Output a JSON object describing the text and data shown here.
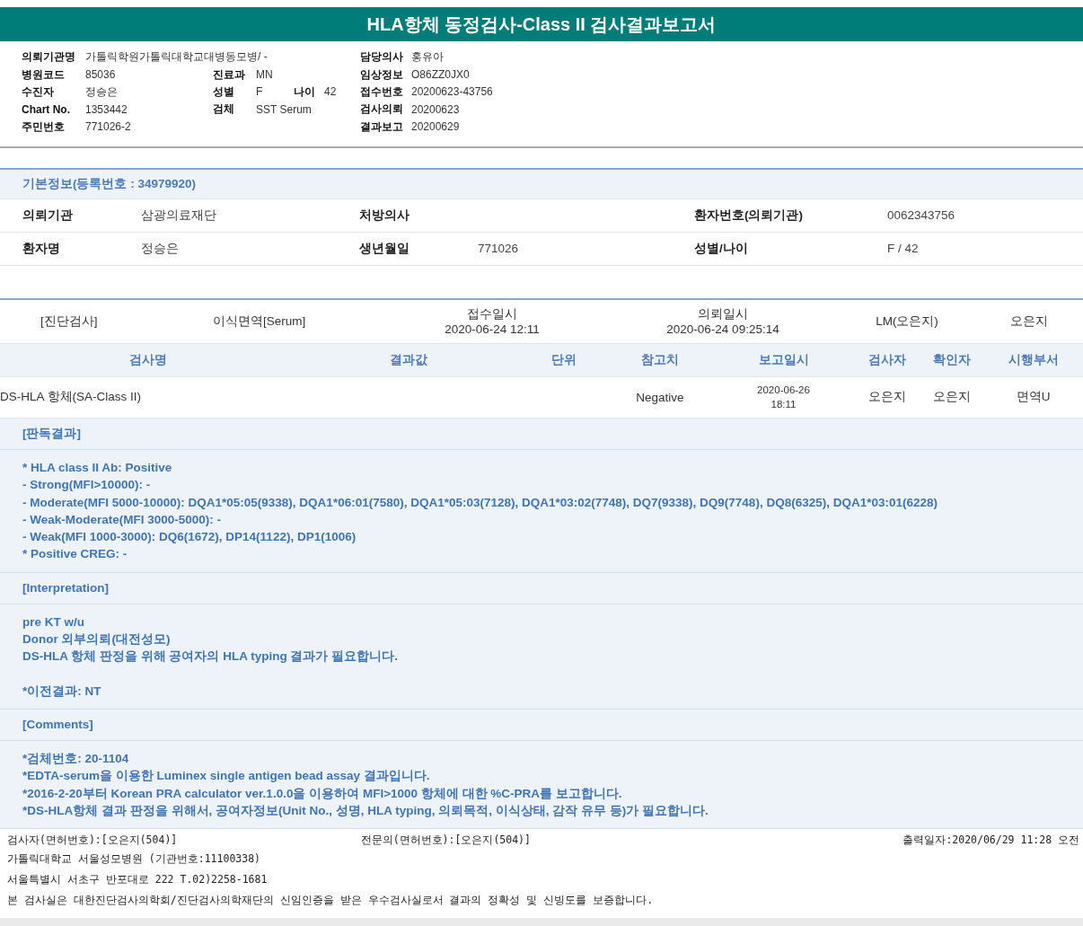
{
  "title": "HLA항체 동정검사-Class II 검사결과보고서",
  "header": {
    "rows": [
      {
        "left": {
          "label": "의뢰기관명",
          "value": "가톨릭학원가톨릭대학교대병동모병/ -"
        },
        "middle": [],
        "right": {
          "label": "담당의사",
          "value": "홍유아"
        }
      },
      {
        "left": {
          "label": "병원코드",
          "value": "85036"
        },
        "middle": [
          {
            "label": "진료과",
            "value": "MN"
          }
        ],
        "right": {
          "label": "임상정보",
          "value": "O86ZZ0JX0"
        }
      },
      {
        "left": {
          "label": "수진자",
          "value": "정승은"
        },
        "middle": [
          {
            "label": "성별",
            "value": "F"
          },
          {
            "label": "나이",
            "value": "42"
          }
        ],
        "right": {
          "label": "접수번호",
          "value": "20200623-43756"
        }
      },
      {
        "left": {
          "label": "Chart No.",
          "value": "1353442"
        },
        "middle": [
          {
            "label": "검체",
            "value": "SST Serum"
          }
        ],
        "right": {
          "label": "검사의뢰",
          "value": "20200623"
        }
      },
      {
        "left": {
          "label": "주민번호",
          "value": "771026-2"
        },
        "middle": [],
        "right": {
          "label": "결과보고",
          "value": "20200629"
        }
      }
    ]
  },
  "basic_info": {
    "title": "기본정보(등록번호 : 34979920)",
    "rows": [
      [
        {
          "label": "의뢰기관",
          "value": "삼광의료재단"
        },
        {
          "label": "처방의사"
        },
        {
          "label": "환자번호(의뢰기관)",
          "value": "0062343756"
        }
      ],
      [
        {
          "label": "환자명",
          "value": "정승은"
        },
        {
          "label": "생년월일",
          "value": "771026"
        },
        {
          "label": "성별/나이",
          "value": "F / 42"
        }
      ]
    ]
  },
  "order": [
    {
      "value": "[진단검사]"
    },
    {
      "value": "이식면역[Serum]"
    },
    {
      "label": "접수일시",
      "value": "2020-06-24 12:11"
    },
    {
      "label": "의뢰일시",
      "value": "2020-06-24 09:25:14"
    },
    {
      "value": "LM(오은지)"
    },
    {
      "value": "오은지"
    }
  ],
  "table": {
    "columns": [
      "검사명",
      "결과값",
      "단위",
      "참고치",
      "보고일시",
      "검사자",
      "확인자",
      "시행부서"
    ],
    "rows": [
      [
        "DS-HLA 항체(SA-Class II)",
        "",
        "",
        "Negative",
        "2020-06-26\n18:11",
        "오은지",
        "오은지",
        "면역U"
      ]
    ]
  },
  "sections": [
    {
      "title": "[판독결과]",
      "paragraphs": [
        [
          "* HLA class II Ab: Positive",
          "- Strong(MFI>10000): -",
          "- Moderate(MFI 5000-10000): DQA1*05:05(9338), DQA1*06:01(7580), DQA1*05:03(7128), DQA1*03:02(7748), DQ7(9338), DQ9(7748), DQ8(6325), DQA1*03:01(6228)",
          "- Weak-Moderate(MFI 3000-5000): -",
          "- Weak(MFI 1000-3000): DQ6(1672), DP14(1122), DP1(1006)",
          "* Positive CREG: -"
        ]
      ]
    },
    {
      "title": "[Interpretation]",
      "paragraphs": [
        [
          "pre KT w/u",
          "Donor 외부의뢰(대전성모)",
          "DS-HLA 항체 판정을 위해 공여자의 HLA typing 결과가 필요합니다."
        ],
        [
          "*이전결과: NT"
        ]
      ]
    },
    {
      "title": "[Comments]",
      "paragraphs": [
        [
          "*검체번호: 20-1104",
          "*EDTA-serum을 이용한 Luminex single antigen bead assay 결과입니다.",
          "*2016-2-20부터 Korean PRA calculator ver.1.0.0을 이용하여 MFI>1000 항체에 대한 %C-PRA를 보고합니다.",
          "*DS-HLA항체 결과 판정을 위해서, 공여자정보(Unit No., 성명, HLA typing, 의뢰목적, 이식상태, 감작 유무 등)가 필요합니다."
        ]
      ]
    }
  ],
  "footer": {
    "signatures": [
      "검사자(면허번호):[오은지(504)]",
      "전문의(면허번호):[오은지(504)]",
      "출력일자:2020/06/29 11:28 오전"
    ],
    "lines": [
      "가톨릭대학교 서울성모병원 (기관번호:11100338)",
      "서울특별시 서초구 반포대로 222 T.02)2258-1681",
      "본 검사실은 대한진단검사의학회/진단검사의학재단의 신임인증을 받은 우수검사실로서 결과의 정확성 및 신빙도를 보증합니다."
    ]
  }
}
